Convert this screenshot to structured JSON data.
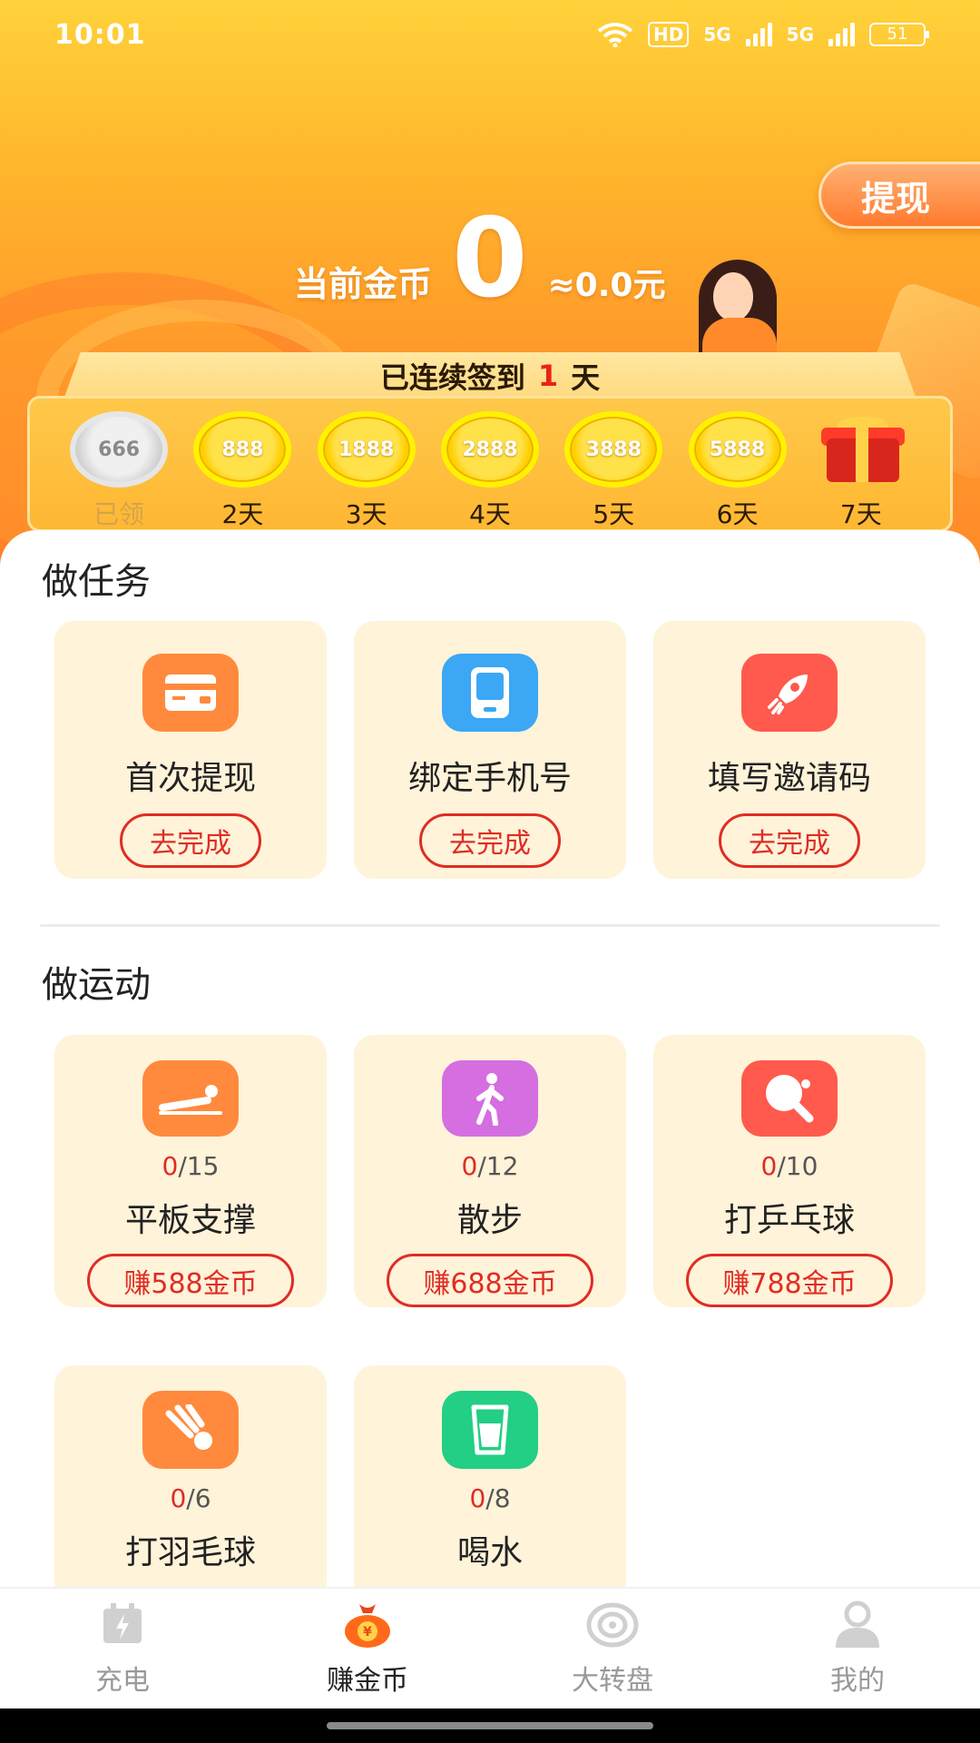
{
  "status_bar": {
    "time": "10:01",
    "hd_label": "HD",
    "signal1_label": "5G",
    "signal2_label": "5G",
    "battery": "51"
  },
  "header": {
    "withdraw_label": "提现",
    "coins_label": "当前金币",
    "coins_value": "0",
    "approx_value": "≈0.0元"
  },
  "signin": {
    "prefix": "已连续签到",
    "days": "1",
    "suffix": "天",
    "days_list": [
      {
        "coin": "666",
        "label": "已领"
      },
      {
        "coin": "888",
        "label": "2天"
      },
      {
        "coin": "1888",
        "label": "3天"
      },
      {
        "coin": "2888",
        "label": "4天"
      },
      {
        "coin": "3888",
        "label": "5天"
      },
      {
        "coin": "5888",
        "label": "6天"
      },
      {
        "coin": "",
        "label": "7天"
      }
    ]
  },
  "tasks": {
    "title": "做任务",
    "items": [
      {
        "title": "首次提现",
        "action": "去完成",
        "icon": "card-icon",
        "color": "#ff8a3d"
      },
      {
        "title": "绑定手机号",
        "action": "去完成",
        "icon": "phone-icon",
        "color": "#3ba7f5"
      },
      {
        "title": "填写邀请码",
        "action": "去完成",
        "icon": "rocket-icon",
        "color": "#ff5a4d"
      }
    ]
  },
  "sports": {
    "title": "做运动",
    "items": [
      {
        "done": "0",
        "total": "/15",
        "title": "平板支撑",
        "action": "赚588金币",
        "icon": "plank-icon",
        "color": "#ff8a3d"
      },
      {
        "done": "0",
        "total": "/12",
        "title": "散步",
        "action": "赚688金币",
        "icon": "walking-icon",
        "color": "#d56ee0"
      },
      {
        "done": "0",
        "total": "/10",
        "title": "打乒乓球",
        "action": "赚788金币",
        "icon": "ping-pong-icon",
        "color": "#ff5a4d"
      },
      {
        "done": "0",
        "total": "/6",
        "title": "打羽毛球",
        "icon": "shuttlecock-icon",
        "color": "#ff8a3d"
      },
      {
        "done": "0",
        "total": "/8",
        "title": "喝水",
        "icon": "water-cup-icon",
        "color": "#22cf84"
      }
    ]
  },
  "nav": {
    "items": [
      {
        "label": "充电",
        "icon": "charging-icon",
        "active": false
      },
      {
        "label": "赚金币",
        "icon": "money-bag-icon",
        "active": true
      },
      {
        "label": "大转盘",
        "icon": "wheel-icon",
        "active": false
      },
      {
        "label": "我的",
        "icon": "profile-icon",
        "active": false
      }
    ]
  },
  "colors": {
    "accent_red": "#e02c24",
    "card_bg": "#fff3d9",
    "header_top": "#ffd23a",
    "header_bottom": "#ff8a2a"
  }
}
